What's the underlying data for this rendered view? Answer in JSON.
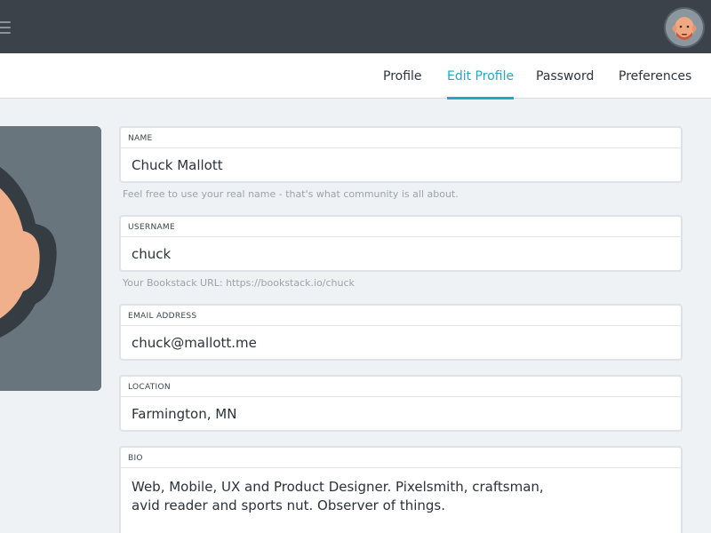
{
  "header": {
    "menu_icon": "hamburger-icon",
    "avatar_icon": "avatar"
  },
  "tabs": [
    {
      "label": "Profile",
      "active": false
    },
    {
      "label": "Edit Profile",
      "active": true
    },
    {
      "label": "Password",
      "active": false
    },
    {
      "label": "Preferences",
      "active": false
    }
  ],
  "form": {
    "name": {
      "label": "NAME",
      "value": "Chuck Mallott",
      "helper": "Feel free to use your real name - that's what community is all about."
    },
    "username": {
      "label": "USERNAME",
      "value": "chuck",
      "helper": "Your Bookstack URL:  https://bookstack.io/chuck"
    },
    "email": {
      "label": "EMAIL ADDRESS",
      "value": "chuck@mallott.me"
    },
    "location": {
      "label": "LOCATION",
      "value": "Farmington, MN"
    },
    "bio": {
      "label": "BIO",
      "value": "Web, Mobile, UX and Product Designer. Pixelsmith, craftsman, avid reader and sports nut. Observer of things."
    }
  },
  "colors": {
    "accent": "#24a7c4",
    "topbar": "#3b4249",
    "background": "#eff2f5"
  }
}
